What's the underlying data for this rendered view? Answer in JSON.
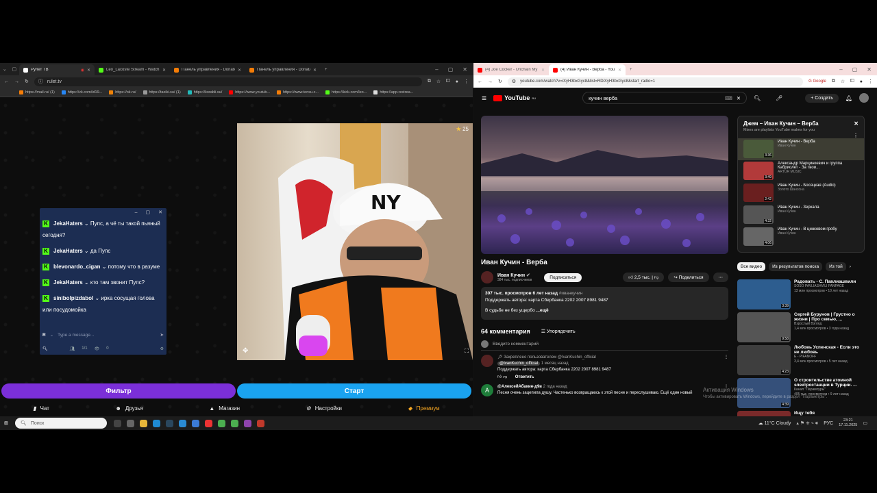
{
  "left_window": {
    "tabs": [
      {
        "title": "Рулет ТВ",
        "color": "#ffffff"
      },
      {
        "title": "Leo_Lacoste Stream - Watch Li",
        "color": "#53fc18"
      },
      {
        "title": "Панель управления - DonatAl",
        "color": "#f57d07"
      },
      {
        "title": "Панель управления - DonatAl",
        "color": "#f57d07"
      }
    ],
    "url": "rulet.tv",
    "bookmarks": [
      "https://mail.ru/ (1)",
      "https://vk.com/id19...",
      "https://ok.ru/",
      "https://taxiki.su/ (1)",
      "https://korabli.su/",
      "https://www.youtub...",
      "https://www.tensu.c...",
      "https://kick.com/leo...",
      "https://app.restrea..."
    ],
    "viewer_count": "25",
    "chat": {
      "messages": [
        {
          "user": "JekaHaters",
          "text": "Пупс, а чё ты такой пьяный сегодня?"
        },
        {
          "user": "JekaHaters",
          "text": "да Пупс"
        },
        {
          "user": "blevonardo_cigan",
          "text": "потому что в разуме"
        },
        {
          "user": "JekaHaters",
          "text": "кто там звонит Пупс?"
        },
        {
          "user": "sinibolpizdabol",
          "text": "ирка сосущая голова или посудомойка"
        }
      ],
      "input_avatar": "R",
      "input_placeholder": "Type a message...",
      "footer_count": "1/1",
      "footer_views": "0"
    },
    "filter_button": "Фильтр",
    "start_button": "Старт",
    "nav": {
      "chat": "Чат",
      "friends": "Друзья",
      "shop": "Магазин",
      "settings": "Настройки",
      "premium": "Премиум"
    }
  },
  "right_window": {
    "tabs": [
      {
        "title": "(4) Joe Cocker - Unchain My H",
        "color": "#ff0000"
      },
      {
        "title": "(4) Иван Кучин - Верба - YouT",
        "color": "#ff0000"
      }
    ],
    "url": "youtube.com/watch?v=iXyH3bxGyc8&list=RDiXyH3bxGyc8&start_radio=1",
    "google_chip": "Google",
    "youtube": {
      "logo": "YouTube",
      "logo_region": "RU",
      "search_query": "кучин верба",
      "create_label": "Создать",
      "video_title": "Иван Кучин - Верба",
      "channel_name": "Иван Кучин",
      "subscribers": "384 тыс. подписчиков",
      "subscribe_label": "Подписаться",
      "likes": "2,5 тыс.",
      "share_label": "Поделиться",
      "desc_stats": "307 тыс. просмотров  6 лет назад",
      "desc_tag": "#иванкучин",
      "desc_line2": "Поддержать автора: карта Сбербанка 2202 2007 8981 9487",
      "desc_line3": "В судьбе не без ущербо",
      "desc_more": "...ещё",
      "comments_count": "64 комментария",
      "sort_label": "Упорядочить",
      "comment_placeholder": "Введите комментарий",
      "pinned_label": "Закреплено пользователем @IvanKuchin_official",
      "pinned_author": "@IvanKuchin_official",
      "pinned_time": "1 месяц назад",
      "pinned_text": "Поддержать автора: карта Сбербанка 2202 2007 8981 9487",
      "reply_label": "Ответить",
      "comment2_author": "@АлексейАбакин-д9в",
      "comment2_time": "2 года назад",
      "comment2_text": "Песня очень зацепила душу. Частенько возвращаюсь к этой песне и переслушиваю. Ещё один новый",
      "playlist": {
        "title": "Джем – Иван Кучин – Верба",
        "subtitle": "Mixes are playlists YouTube makes for you",
        "items": [
          {
            "title": "Иван Кучин - Верба",
            "channel": "Иван Кучин",
            "duration": "3:36"
          },
          {
            "title": "Александр Марцинкевич и группа Кабриолет - За твои...",
            "channel": "ARTUR MUSIC",
            "duration": "3:49"
          },
          {
            "title": "Иван Кучин - Босяцкая (Audio)",
            "channel": "Золото Шансона",
            "duration": "2:42"
          },
          {
            "title": "Иван Кучин - Зеркала",
            "channel": "Иван Кучин",
            "duration": "4:32"
          },
          {
            "title": "Иван Кучин - В цинковом гробу",
            "channel": "Иван Кучин",
            "duration": "4:06"
          }
        ]
      },
      "chips": [
        "Все видео",
        "Из результатов поиска",
        "Из той"
      ],
      "recommended": [
        {
          "title": "Радовать - С. Павлиашвили",
          "channel": "SOSO PAVLIASHVILI FANPAGE",
          "meta": "13 млн просмотров • 10 лет назад",
          "duration": "3:39"
        },
        {
          "title": "Сергей Бурунов | Грустно о жизни | Про семью, ...",
          "channel": "Взрослый Взгляд",
          "meta": "1,4 млн просмотров • 3 года назад",
          "duration": "9:58"
        },
        {
          "title": "Любовь Успенская - Если это не любовь",
          "channel": "E - PIFANOFF",
          "meta": "3,4 млн просмотров • 5 лет назад",
          "duration": "4:23"
        },
        {
          "title": "О строительстве атомной электростанции в Турции. ...",
          "channel": "Канал \"Парамоуры\"",
          "meta": "405 тыс. просмотров • 9 лет назад",
          "duration": "4:39"
        },
        {
          "title": "Ищу тебя",
          "channel": "",
          "meta": "",
          "duration": ""
        }
      ],
      "activation_line1": "Активация Windows",
      "activation_line2": "Чтобы активировать Windows, перейдите в раздел \"Параметры\"."
    }
  },
  "taskbar": {
    "search_placeholder": "Поиск",
    "weather": "11°C  Cloudy",
    "lang": "РУС",
    "time": "23:21",
    "date": "17.11.2025"
  }
}
